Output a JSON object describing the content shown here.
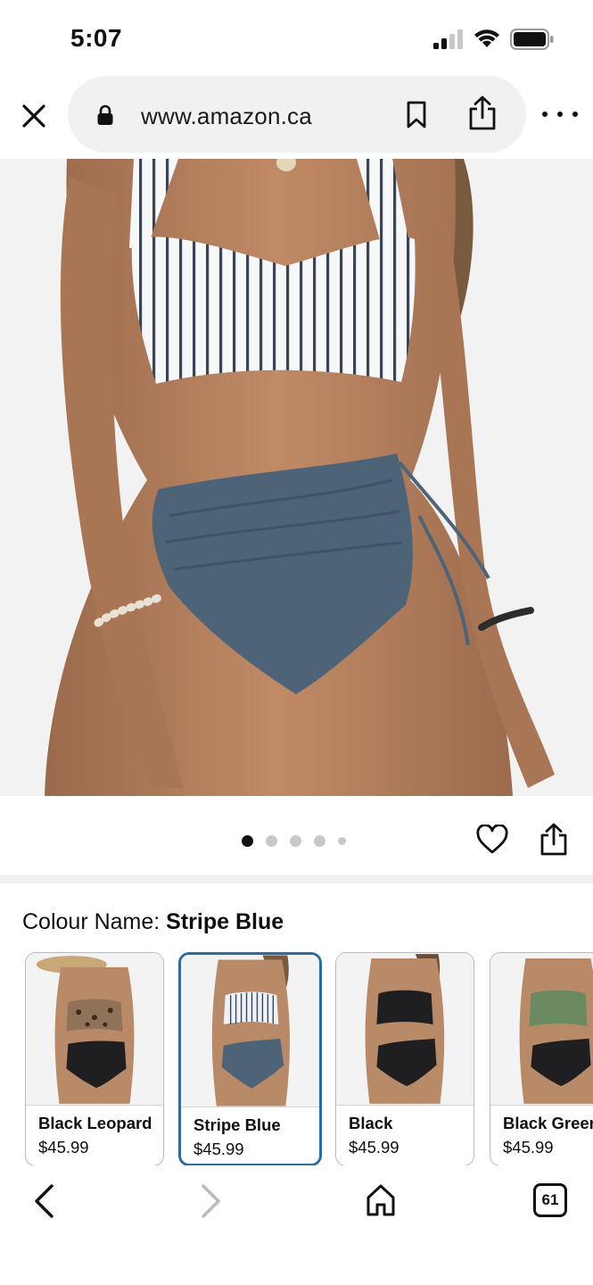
{
  "status_bar": {
    "time": "5:07",
    "icons": [
      "signal-icon",
      "wifi-icon",
      "battery-icon"
    ]
  },
  "browser": {
    "url": "www.amazon.ca",
    "icons": [
      "close-icon",
      "lock-icon",
      "bookmark-icon",
      "share-icon",
      "more-icon"
    ]
  },
  "gallery": {
    "image_count": 5,
    "active_index": 0
  },
  "colour": {
    "label": "Colour Name: ",
    "selected": "Stripe Blue"
  },
  "swatches": [
    {
      "name": "Black Leopard",
      "price": "$45.99",
      "selected": false
    },
    {
      "name": "Stripe Blue",
      "price": "$45.99",
      "selected": true
    },
    {
      "name": "Black",
      "price": "$45.99",
      "selected": false
    },
    {
      "name": "Black Green",
      "price": "$45.99",
      "selected": false
    }
  ],
  "bottom_nav": {
    "tabs_count": "61",
    "icons": [
      "back-icon",
      "forward-icon",
      "home-icon",
      "tabs-icon"
    ]
  },
  "colors": {
    "accent": "#2f6ba3",
    "swim_blue": "#4d6478",
    "text": "#0f1111"
  }
}
